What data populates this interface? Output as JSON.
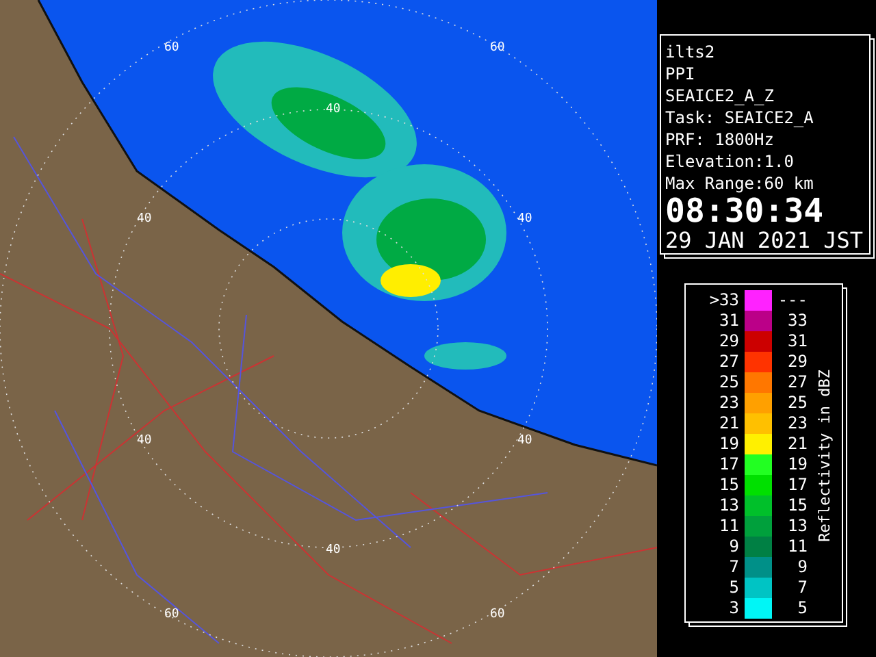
{
  "map": {
    "ring_labels": [
      "60",
      "60",
      "40",
      "40",
      "40",
      "40",
      "40",
      "40",
      "60",
      "60"
    ]
  },
  "info": {
    "lines": [
      "ilts2",
      "PPI",
      "SEAICE2_A_Z",
      "Task: SEAICE2_A",
      "PRF: 1800Hz",
      "Elevation:1.0",
      "Max Range:60 km"
    ],
    "time": "08:30:34",
    "date": "29 JAN 2021 JST"
  },
  "legend": {
    "title": "Reflectivity in dBZ",
    "rows": [
      {
        "low": ">33",
        "high": "---",
        "color": "#ff22ff"
      },
      {
        "low": "31",
        "high": "33",
        "color": "#bb0088"
      },
      {
        "low": "29",
        "high": "31",
        "color": "#cc0000"
      },
      {
        "low": "27",
        "high": "29",
        "color": "#ff3300"
      },
      {
        "low": "25",
        "high": "27",
        "color": "#ff7700"
      },
      {
        "low": "23",
        "high": "25",
        "color": "#ffa000"
      },
      {
        "low": "21",
        "high": "23",
        "color": "#ffc000"
      },
      {
        "low": "19",
        "high": "21",
        "color": "#fff000"
      },
      {
        "low": "17",
        "high": "19",
        "color": "#22ff22"
      },
      {
        "low": "15",
        "high": "17",
        "color": "#00e000"
      },
      {
        "low": "13",
        "high": "15",
        "color": "#00c02a"
      },
      {
        "low": "11",
        "high": "13",
        "color": "#00a03c"
      },
      {
        "low": "9",
        "high": "11",
        "color": "#008044"
      },
      {
        "low": "7",
        "high": "9",
        "color": "#009088"
      },
      {
        "low": "5",
        "high": "7",
        "color": "#00c4c4"
      },
      {
        "low": "3",
        "high": "5",
        "color": "#00f6f6"
      }
    ]
  }
}
